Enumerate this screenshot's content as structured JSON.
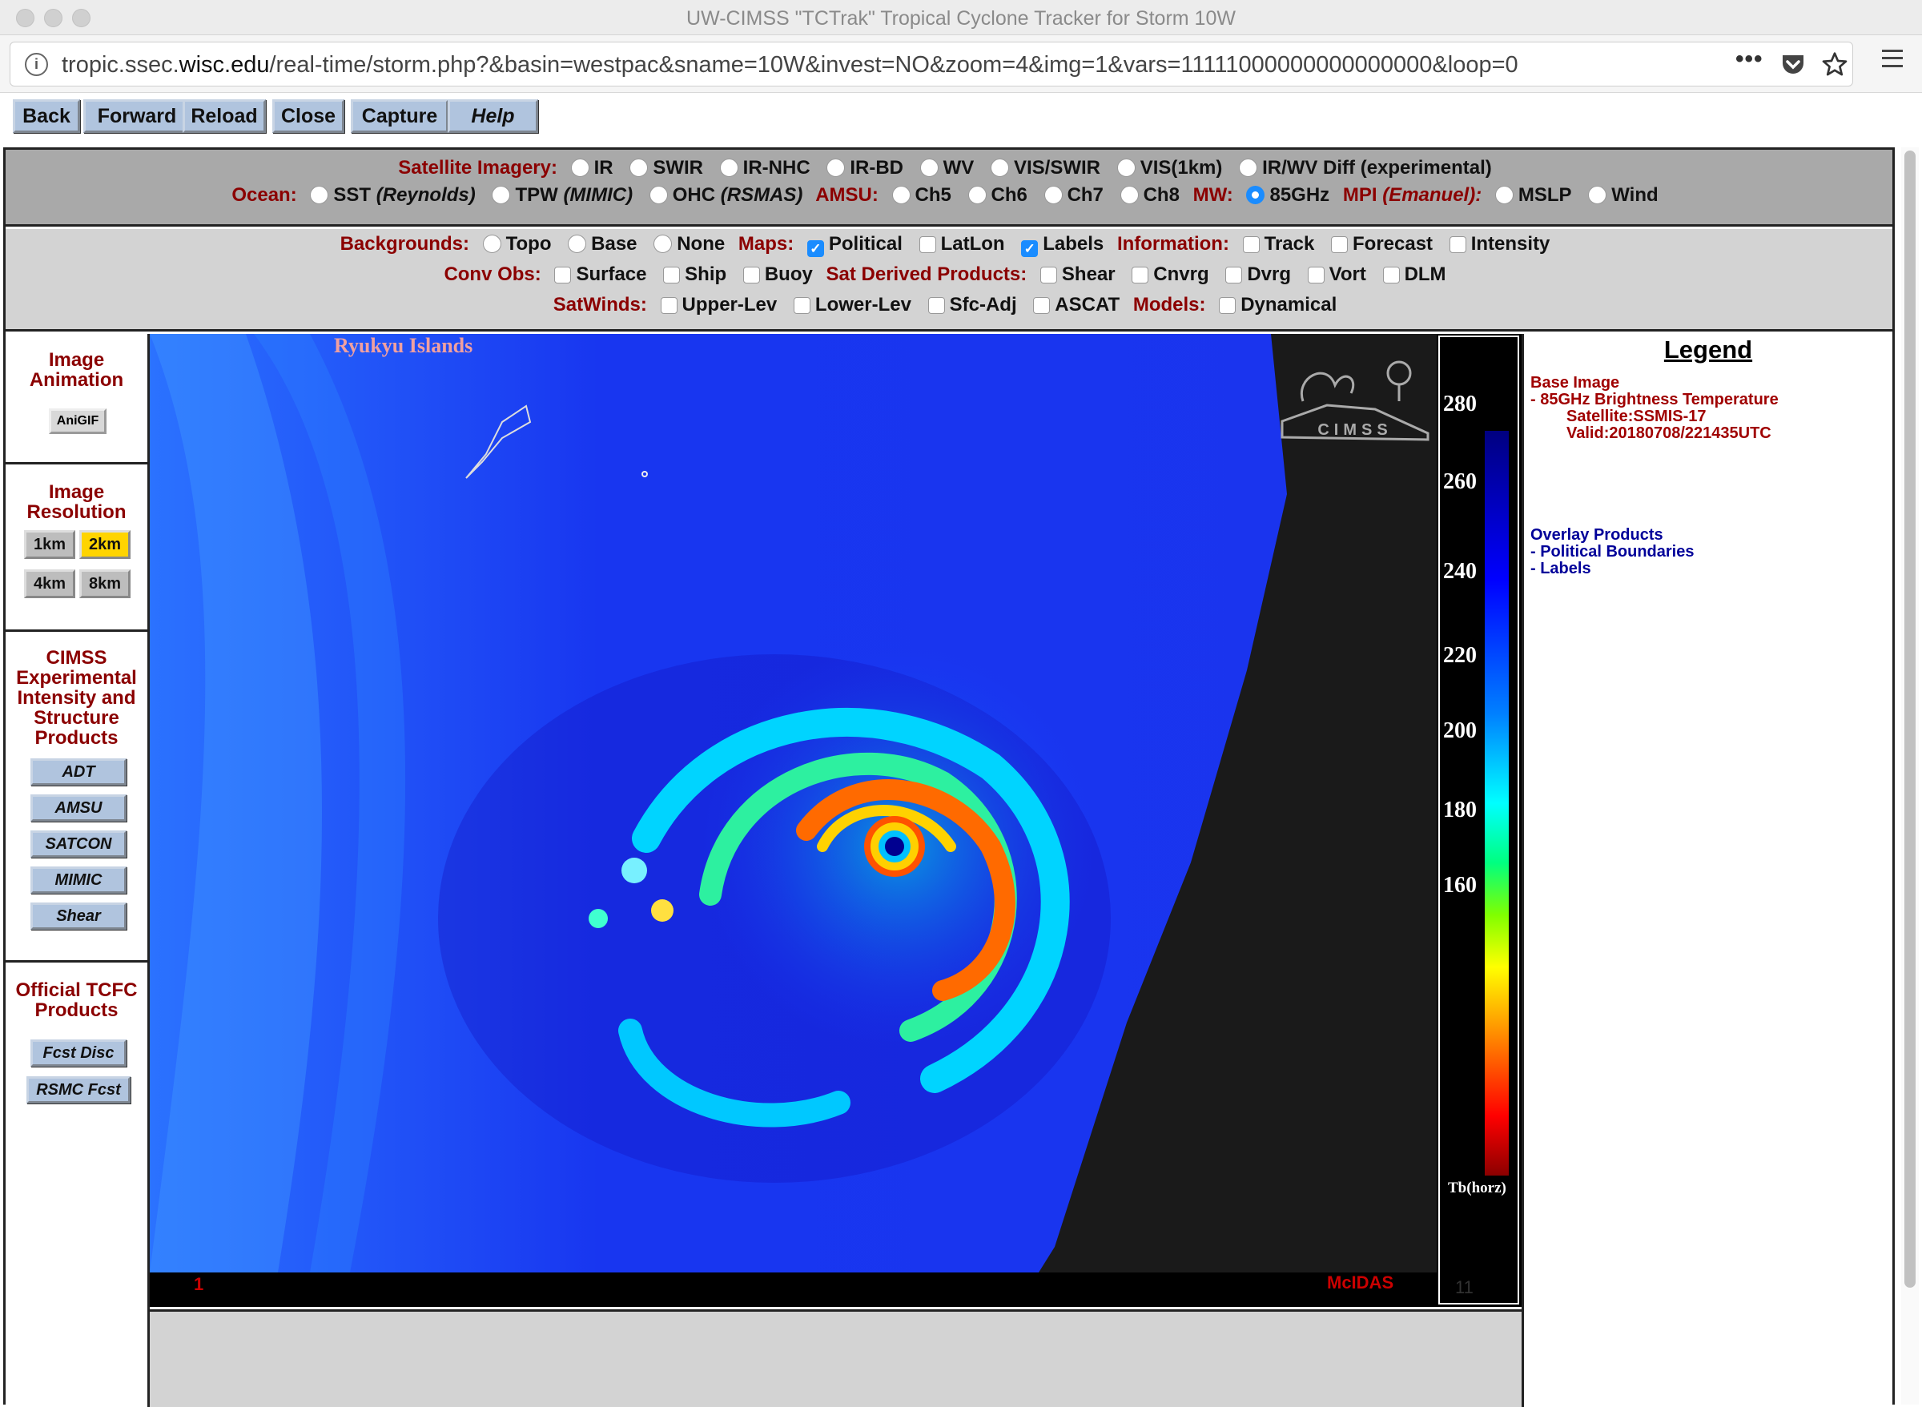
{
  "window": {
    "title": "UW-CIMSS \"TCTrak\" Tropical Cyclone Tracker for Storm 10W"
  },
  "browser": {
    "url_pre": "tropic.ssec.",
    "url_domain": "wisc.edu",
    "url_post": "/real-time/storm.php?&basin=westpac&sname=10W&invest=NO&zoom=4&img=1&vars=11111000000000000000&loop=0"
  },
  "toolbar": {
    "back": "Back",
    "forward": "Forward",
    "reload": "Reload",
    "close": "Close",
    "capture": "Capture",
    "help": "Help"
  },
  "satellite": {
    "label": "Satellite Imagery:",
    "options": [
      "IR",
      "SWIR",
      "IR-NHC",
      "IR-BD",
      "WV",
      "VIS/SWIR",
      "VIS(1km)",
      "IR/WV Diff (experimental)"
    ]
  },
  "ocean": {
    "label": "Ocean:",
    "sst": "SST",
    "sst_src": "(Reynolds)",
    "tpw": "TPW",
    "tpw_src": "(MIMIC)",
    "ohc": "OHC",
    "ohc_src": "(RSMAS)",
    "amsu_label": "AMSU:",
    "amsu": [
      "Ch5",
      "Ch6",
      "Ch7",
      "Ch8"
    ],
    "mw_label": "MW:",
    "mw": "85GHz",
    "mw_selected": true,
    "mpi_label": "MPI",
    "mpi_src": "(Emanuel):",
    "mpi": [
      "MSLP",
      "Wind"
    ]
  },
  "backgrounds": {
    "label": "Backgrounds:",
    "options": [
      "Topo",
      "Base",
      "None"
    ],
    "maps_label": "Maps:",
    "maps": [
      {
        "name": "Political",
        "checked": true
      },
      {
        "name": "LatLon",
        "checked": false
      },
      {
        "name": "Labels",
        "checked": true
      }
    ],
    "info_label": "Information:",
    "info": [
      "Track",
      "Forecast",
      "Intensity"
    ]
  },
  "convobs": {
    "label": "Conv Obs:",
    "options": [
      "Surface",
      "Ship",
      "Buoy"
    ],
    "sat_label": "Sat Derived Products:",
    "sat": [
      "Shear",
      "Cnvrg",
      "Dvrg",
      "Vort",
      "DLM"
    ]
  },
  "satwinds": {
    "label": "SatWinds:",
    "options": [
      "Upper-Lev",
      "Lower-Lev",
      "Sfc-Adj",
      "ASCAT"
    ],
    "models_label": "Models:",
    "models": [
      "Dynamical"
    ]
  },
  "left": {
    "anim_title": "Image Animation",
    "anigif": "AniGIF",
    "res_title": "Image Resolution",
    "res": [
      "1km",
      "2km",
      "4km",
      "8km"
    ],
    "res_selected": "2km",
    "cimss_title": "CIMSS Experimental Intensity and Structure Products",
    "cimss": [
      "ADT",
      "AMSU",
      "SATCON",
      "MIMIC",
      "Shear"
    ],
    "tcfc_title": "Official TCFC Products",
    "tcfc": [
      "Fcst Disc",
      "RSMC Fcst"
    ]
  },
  "image": {
    "map_label": "Ryukyu Islands",
    "logo_text": "CIMSS",
    "colorbar_ticks": [
      "280",
      "260",
      "240",
      "220",
      "200",
      "180",
      "160"
    ],
    "colorbar_unit": "Tb(horz)",
    "frame": "1",
    "mcidas": "McIDAS",
    "frame_count": "11"
  },
  "legend": {
    "title": "Legend",
    "base_head": "Base Image",
    "base_item": "-  85GHz Brightness Temperature",
    "satellite": "Satellite:SSMIS-17",
    "valid": "Valid:20180708/221435UTC",
    "overlay_head": "Overlay Products",
    "overlay": [
      "-  Political Boundaries",
      "-  Labels"
    ]
  }
}
